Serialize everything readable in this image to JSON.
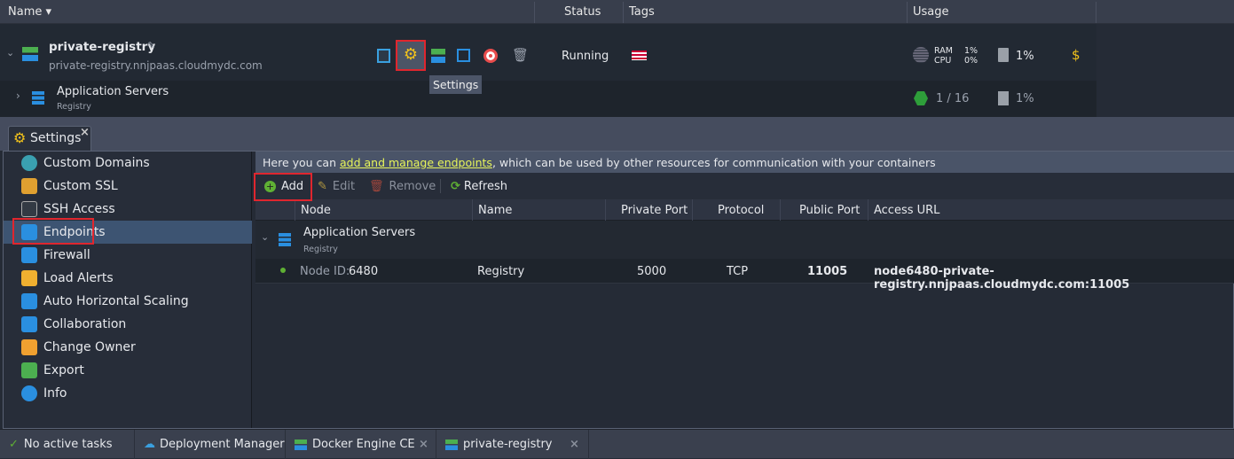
{
  "header": {
    "name": "Name",
    "status": "Status",
    "tags": "Tags",
    "usage": "Usage"
  },
  "env": {
    "name": "private-registry",
    "domain": "private-registry.nnjpaas.cloudmydc.com",
    "status": "Running",
    "ram_label": "RAM",
    "ram": "1%",
    "cpu_label": "CPU",
    "cpu": "0%",
    "disk": "1%",
    "tooltip": "Settings"
  },
  "node_group": {
    "name": "Application Servers",
    "sub": "Registry",
    "cloudlets": "1 / 16",
    "disk": "1%"
  },
  "settings_tab": "Settings",
  "sidebar": {
    "items": [
      {
        "label": "Custom Domains",
        "icon": "globe-icon"
      },
      {
        "label": "Custom SSL",
        "icon": "certificate-icon"
      },
      {
        "label": "SSH Access",
        "icon": "terminal-icon"
      },
      {
        "label": "Endpoints",
        "icon": "endpoints-icon"
      },
      {
        "label": "Firewall",
        "icon": "shield-icon"
      },
      {
        "label": "Load Alerts",
        "icon": "alert-icon"
      },
      {
        "label": "Auto Horizontal Scaling",
        "icon": "scaling-icon"
      },
      {
        "label": "Collaboration",
        "icon": "handshake-icon"
      },
      {
        "label": "Change Owner",
        "icon": "users-icon"
      },
      {
        "label": "Export",
        "icon": "export-icon"
      },
      {
        "label": "Info",
        "icon": "info-icon"
      }
    ],
    "selected": "Endpoints"
  },
  "info": {
    "pre": "Here you can ",
    "link": "add and manage endpoints",
    "post": ", which can be used by other resources for communication with your containers"
  },
  "toolbar": {
    "add": "Add",
    "edit": "Edit",
    "remove": "Remove",
    "refresh": "Refresh"
  },
  "table": {
    "columns": [
      "Node",
      "Name",
      "Private Port",
      "Protocol",
      "Public Port",
      "Access URL"
    ],
    "group": {
      "name": "Application Servers",
      "sub": "Registry"
    },
    "rows": [
      {
        "node_label": "Node ID:",
        "node_id": "6480",
        "name": "Registry",
        "private_port": "5000",
        "protocol": "TCP",
        "public_port": "11005",
        "url": "node6480-private-registry.nnjpaas.cloudmydc.com:11005"
      }
    ]
  },
  "footer": {
    "tasks": "No active tasks",
    "tabs": [
      "Deployment Manager",
      "Docker Engine CE",
      "private-registry"
    ]
  },
  "colors": {
    "accent_red": "#e0262e",
    "link": "#e7f55a",
    "selected": "#3d5472"
  }
}
